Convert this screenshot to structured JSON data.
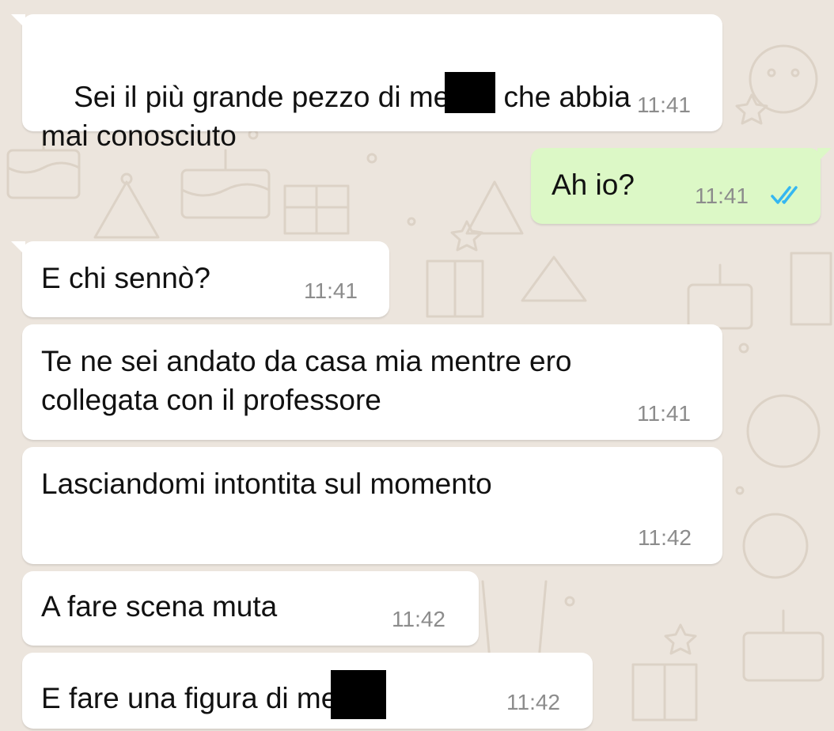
{
  "chat": {
    "messages": [
      {
        "direction": "incoming",
        "text_line1_a": "Sei il più grande pezzo di me",
        "text_line1_b": " che abbia",
        "text_line2": "mai conosciuto",
        "redacted": true,
        "time": "11:41"
      },
      {
        "direction": "outgoing",
        "text": "Ah io?",
        "time": "11:41",
        "status": "read",
        "status_icon": "double-check-icon",
        "status_color": "#34B7F1"
      },
      {
        "direction": "incoming",
        "text": "E chi sennò?",
        "time": "11:41"
      },
      {
        "direction": "incoming",
        "text_line1": "Te ne sei andato da casa mia mentre ero",
        "text_line2": "collegata con il professore",
        "time": "11:41"
      },
      {
        "direction": "incoming",
        "text": "Lasciandomi intontita sul momento",
        "time": "11:42"
      },
      {
        "direction": "incoming",
        "text": "A fare scena muta",
        "time": "11:42"
      },
      {
        "direction": "incoming",
        "text": "E fare una figura di me",
        "redacted": true,
        "time": "11:42"
      }
    ]
  },
  "colors": {
    "wallpaper": "#ECE5DD",
    "incoming_bubble": "#FFFFFF",
    "outgoing_bubble": "#DCF8C6",
    "timestamp": "#8C8C8C",
    "read_ticks": "#34B7F1",
    "redaction": "#000000"
  }
}
